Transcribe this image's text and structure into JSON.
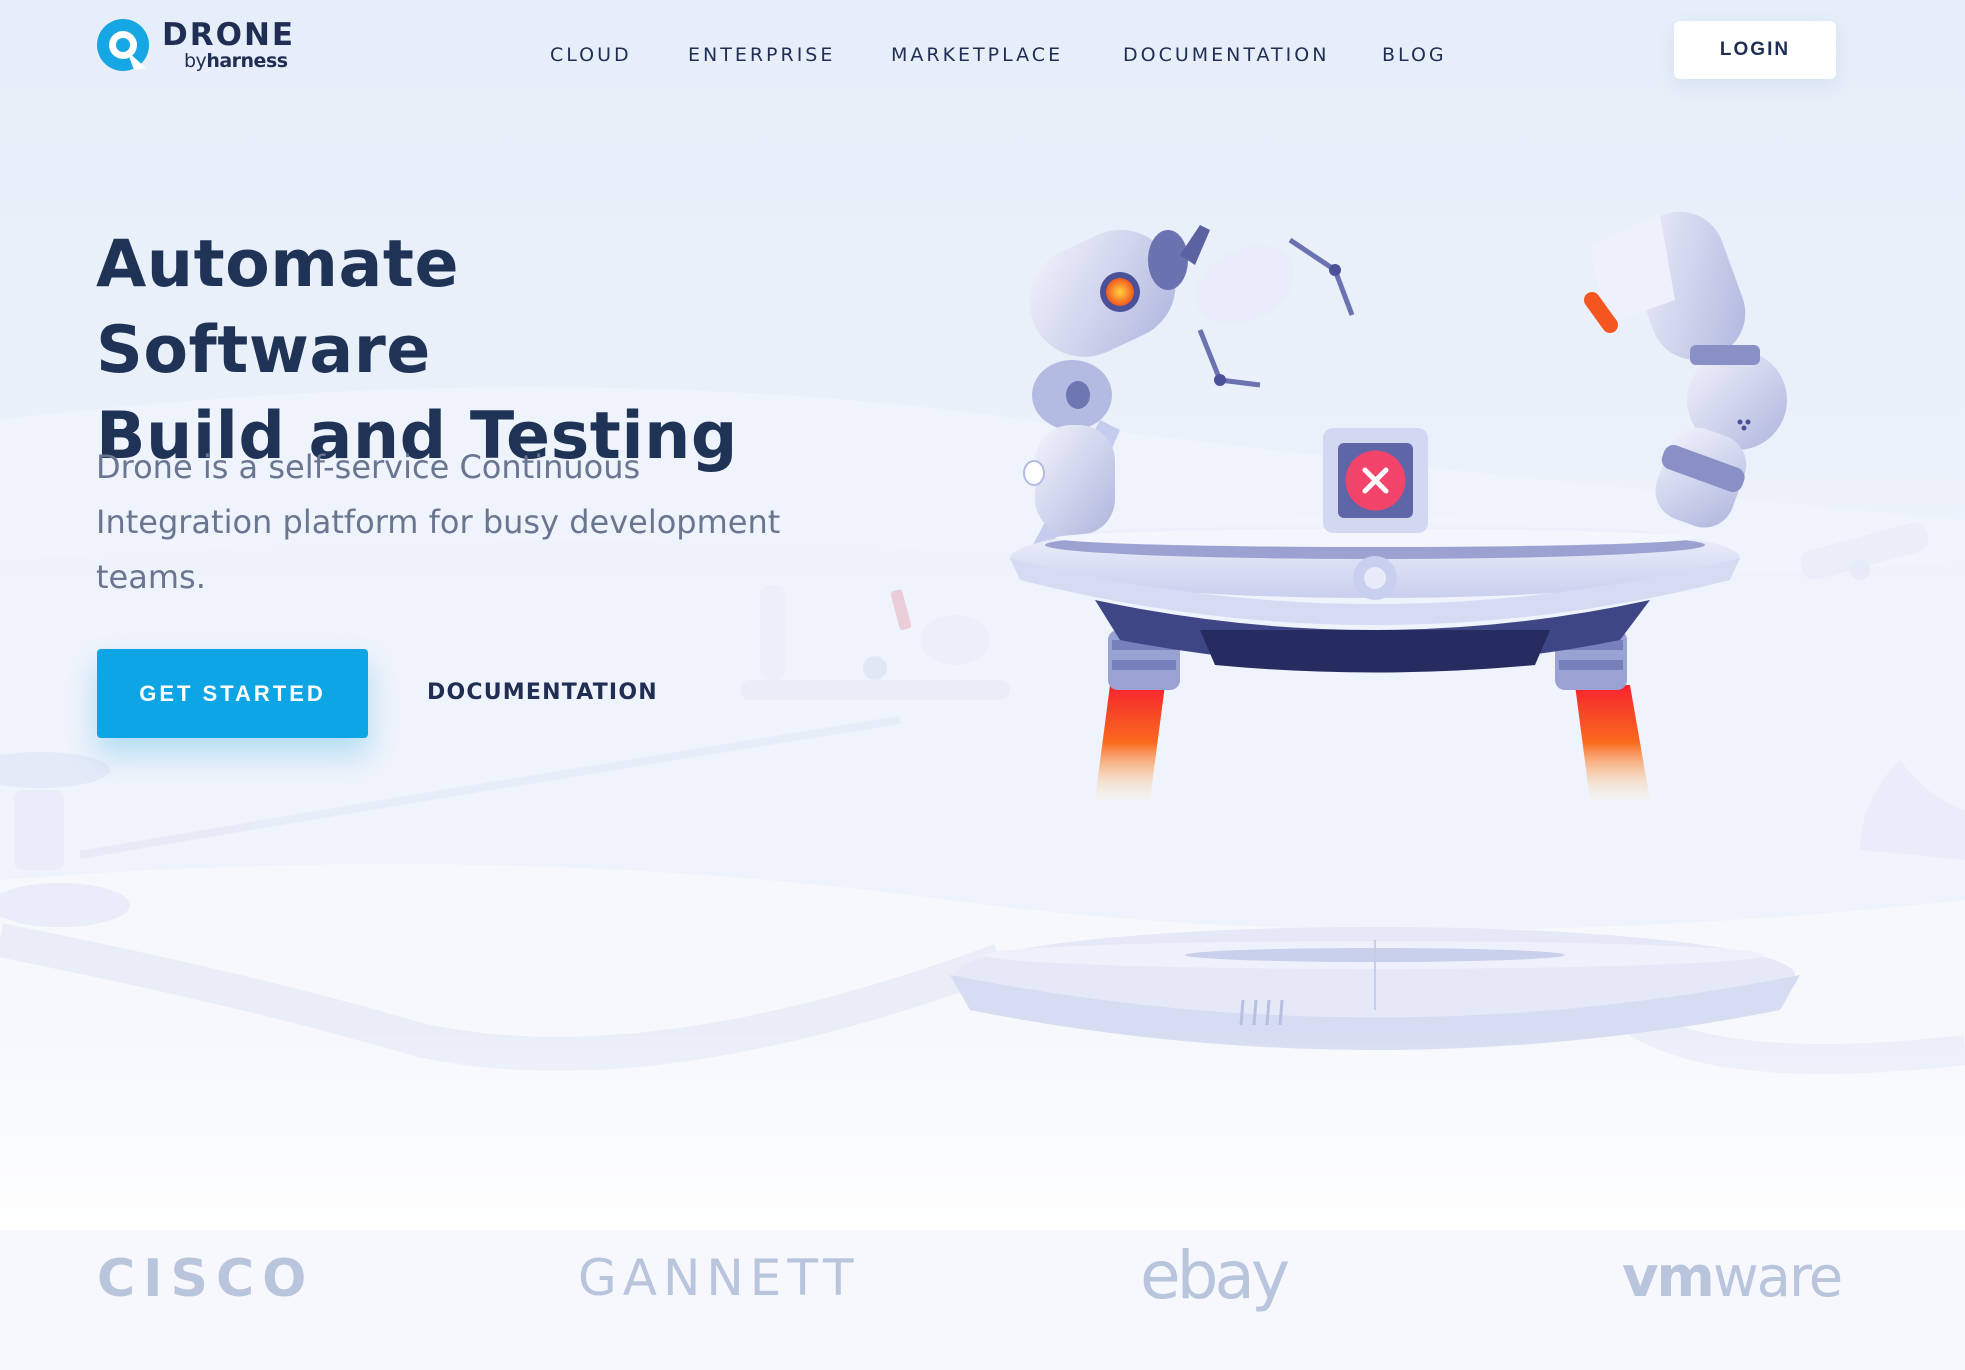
{
  "brand": {
    "name": "DRONE",
    "by": "by",
    "byline": "harness"
  },
  "nav": [
    {
      "label": "CLOUD"
    },
    {
      "label": "ENTERPRISE"
    },
    {
      "label": "MARKETPLACE"
    },
    {
      "label": "DOCUMENTATION"
    },
    {
      "label": "BLOG"
    }
  ],
  "header": {
    "login_label": "LOGIN"
  },
  "hero": {
    "title_line1": "Automate Software",
    "title_line2": "Build and Testing",
    "subtitle": "Drone is a self-service Continuous Integration platform for busy development teams.",
    "primary_cta": "GET STARTED",
    "secondary_cta": "DOCUMENTATION"
  },
  "clients": {
    "cisco": "CISCO",
    "gannett": "GANNETT",
    "ebay": "ebay",
    "vm": "vm",
    "ware": "ware"
  },
  "colors": {
    "accent": "#0ea5e4",
    "navy": "#1f2e52",
    "subtitle": "#6a7690",
    "client_logo": "#b9c5dc",
    "error": "#f2436a"
  },
  "illustration": {
    "subject": "robot-drone-platform",
    "status_icon": "close-icon"
  }
}
